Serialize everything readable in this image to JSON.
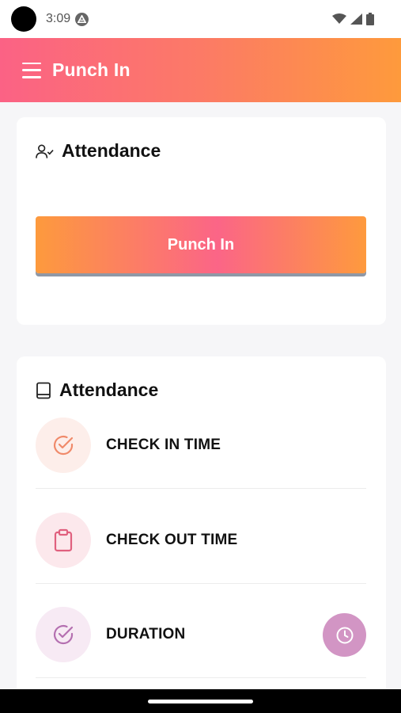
{
  "status_bar": {
    "time": "3:09"
  },
  "app_bar": {
    "title": "Punch In"
  },
  "punch_card": {
    "title": "Attendance",
    "button_label": "Punch In"
  },
  "attendance_card": {
    "title": "Attendance",
    "items": [
      {
        "label": "CHECK IN TIME",
        "icon": "check-circle-icon",
        "color": "#f08a6a"
      },
      {
        "label": "CHECK OUT TIME",
        "icon": "clipboard-icon",
        "color": "#e0607e"
      },
      {
        "label": "DURATION",
        "icon": "check-circle-icon",
        "color": "#b46fb0"
      }
    ]
  },
  "fab": {
    "icon": "clock-icon",
    "color": "#d295c4"
  },
  "colors": {
    "gradient_start": "#fb6285",
    "gradient_end": "#fe9a3c"
  }
}
